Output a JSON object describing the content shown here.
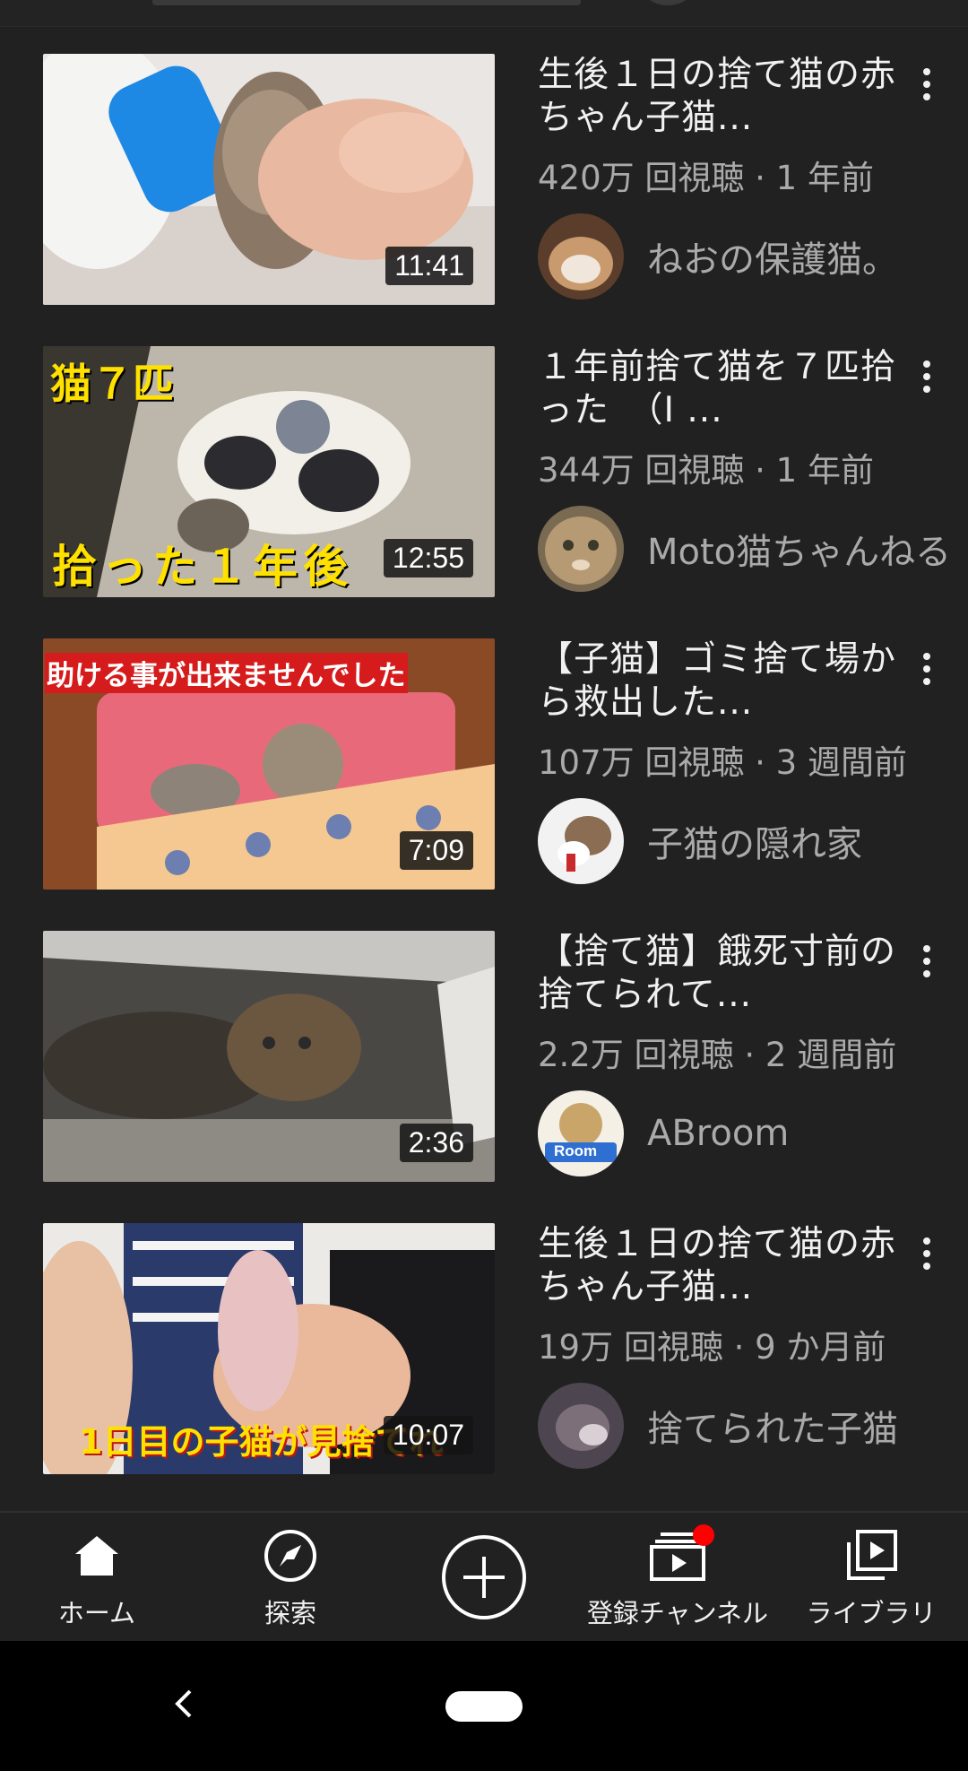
{
  "videos": [
    {
      "title": "生後１日の捨て猫の赤ちゃん子猫...",
      "stats": "420万 回視聴 · 1 年前",
      "channel": "ねおの保護猫。",
      "duration": "11:41",
      "overlay_top": "",
      "overlay_bottom": ""
    },
    {
      "title": "１年前捨て猫を７匹拾った　（I ...",
      "stats": "344万 回視聴 · 1 年前",
      "channel": "Moto猫ちゃんねる",
      "duration": "12:55",
      "overlay_top": "猫７匹",
      "overlay_bottom": "拾った１年後"
    },
    {
      "title": "【子猫】ゴミ捨て場から救出した...",
      "stats": "107万 回視聴 · 3 週間前",
      "channel": "子猫の隠れ家",
      "duration": "7:09",
      "overlay_top": "助ける事が出来ませんでした",
      "overlay_bottom": ""
    },
    {
      "title": "【捨て猫】餓死寸前の捨てられて...",
      "stats": "2.2万 回視聴 · 2 週間前",
      "channel": "ABroom",
      "duration": "2:36",
      "overlay_top": "",
      "overlay_bottom": "",
      "avatar_text": "Room"
    },
    {
      "title": "生後１日の捨て猫の赤ちゃん子猫...",
      "stats": "19万 回視聴 · 9 か月前",
      "channel": "捨てられた子猫",
      "duration": "10:07",
      "overlay_top": "",
      "overlay_bottom": "1日目の子猫が見捨てれ"
    }
  ],
  "bottom_nav": {
    "home": "ホーム",
    "explore": "探索",
    "subscriptions": "登録チャンネル",
    "library": "ライブラリ"
  },
  "colors": {
    "background": "#212121",
    "text_primary": "#f1f1f1",
    "text_secondary": "#aaaaaa",
    "notification": "#ff0000"
  }
}
